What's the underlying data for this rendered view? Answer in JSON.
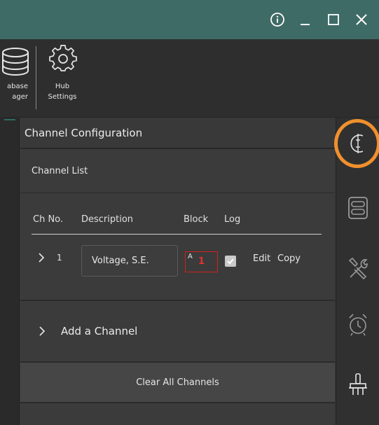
{
  "window": {
    "controls": [
      "info-icon",
      "minimize-icon",
      "maximize-icon",
      "close-icon"
    ]
  },
  "toolbar": {
    "database_label": "abase\nager",
    "hub_label": "Hub\nSettings"
  },
  "panel": {
    "title": "Channel Configuration",
    "channel_list_label": "Channel List",
    "columns": {
      "ch_no": "Ch No.",
      "description": "Description",
      "block": "Block",
      "log": "Log"
    },
    "rows": [
      {
        "ch_no": "1",
        "description": "Voltage, S.E.",
        "block_prefix": "A",
        "block": "1",
        "log_checked": true,
        "edit_label": "Edit",
        "copy_label": "Copy"
      }
    ],
    "add_channel_label": "Add a Channel",
    "clear_all_label": "Clear All Channels"
  },
  "sidebar": {
    "icons": [
      "channel-config-icon",
      "storage-icon",
      "tools-icon",
      "alarm-clock-icon",
      "cleanup-brush-icon"
    ],
    "active": "channel-config-icon"
  },
  "colors": {
    "titlebar": "#3f6b66",
    "highlight_ring": "#f0902c",
    "block_error": "#d42020"
  }
}
